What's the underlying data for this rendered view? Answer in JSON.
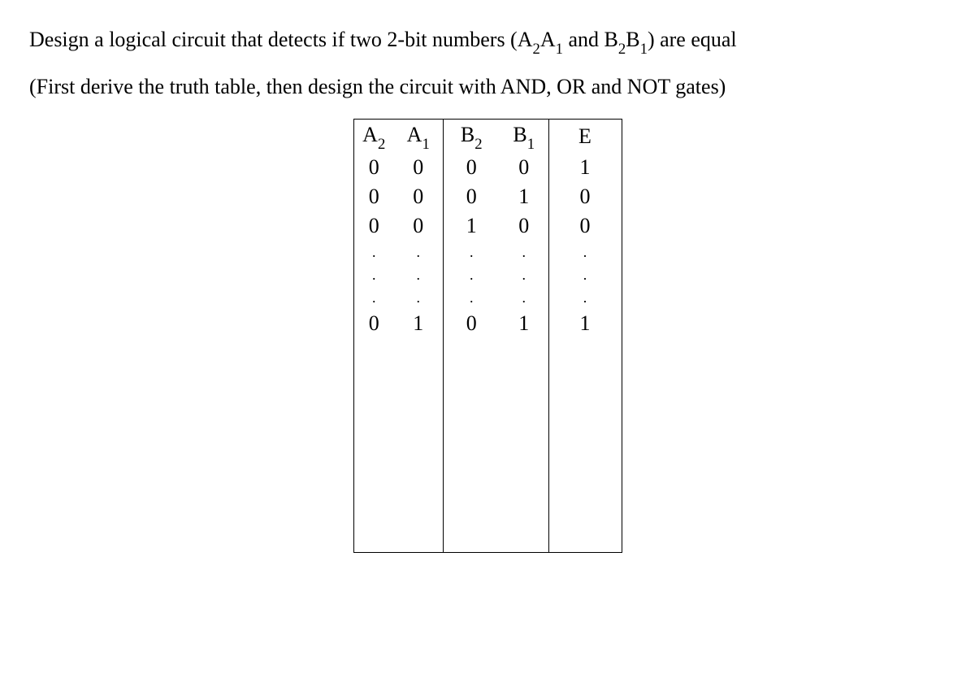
{
  "problem": {
    "line1_pre": "Design a logical circuit that detects if two 2-bit numbers (A",
    "line1_sub1": "2",
    "line1_mid1": "A",
    "line1_sub2": "1",
    "line1_mid2": " and B",
    "line1_sub3": "2",
    "line1_mid3": "B",
    "line1_sub4": "1",
    "line1_post": ") are equal",
    "line2": "(First derive the truth table, then design the circuit with AND, OR and NOT gates)"
  },
  "table": {
    "headers": {
      "a2": "A",
      "a2_sub": "2",
      "a1": "A",
      "a1_sub": "1",
      "b2": "B",
      "b2_sub": "2",
      "b1": "B",
      "b1_sub": "1",
      "e": "E"
    },
    "rows": [
      {
        "a2": "0",
        "a1": "0",
        "b2": "0",
        "b1": "0",
        "e": "1"
      },
      {
        "a2": "0",
        "a1": "0",
        "b2": "0",
        "b1": "1",
        "e": "0"
      },
      {
        "a2": "0",
        "a1": "0",
        "b2": "1",
        "b1": "0",
        "e": "0"
      }
    ],
    "dot": ".",
    "last_row": {
      "a2": "0",
      "a1": "1",
      "b2": "0",
      "b1": "1",
      "e": "1"
    }
  }
}
